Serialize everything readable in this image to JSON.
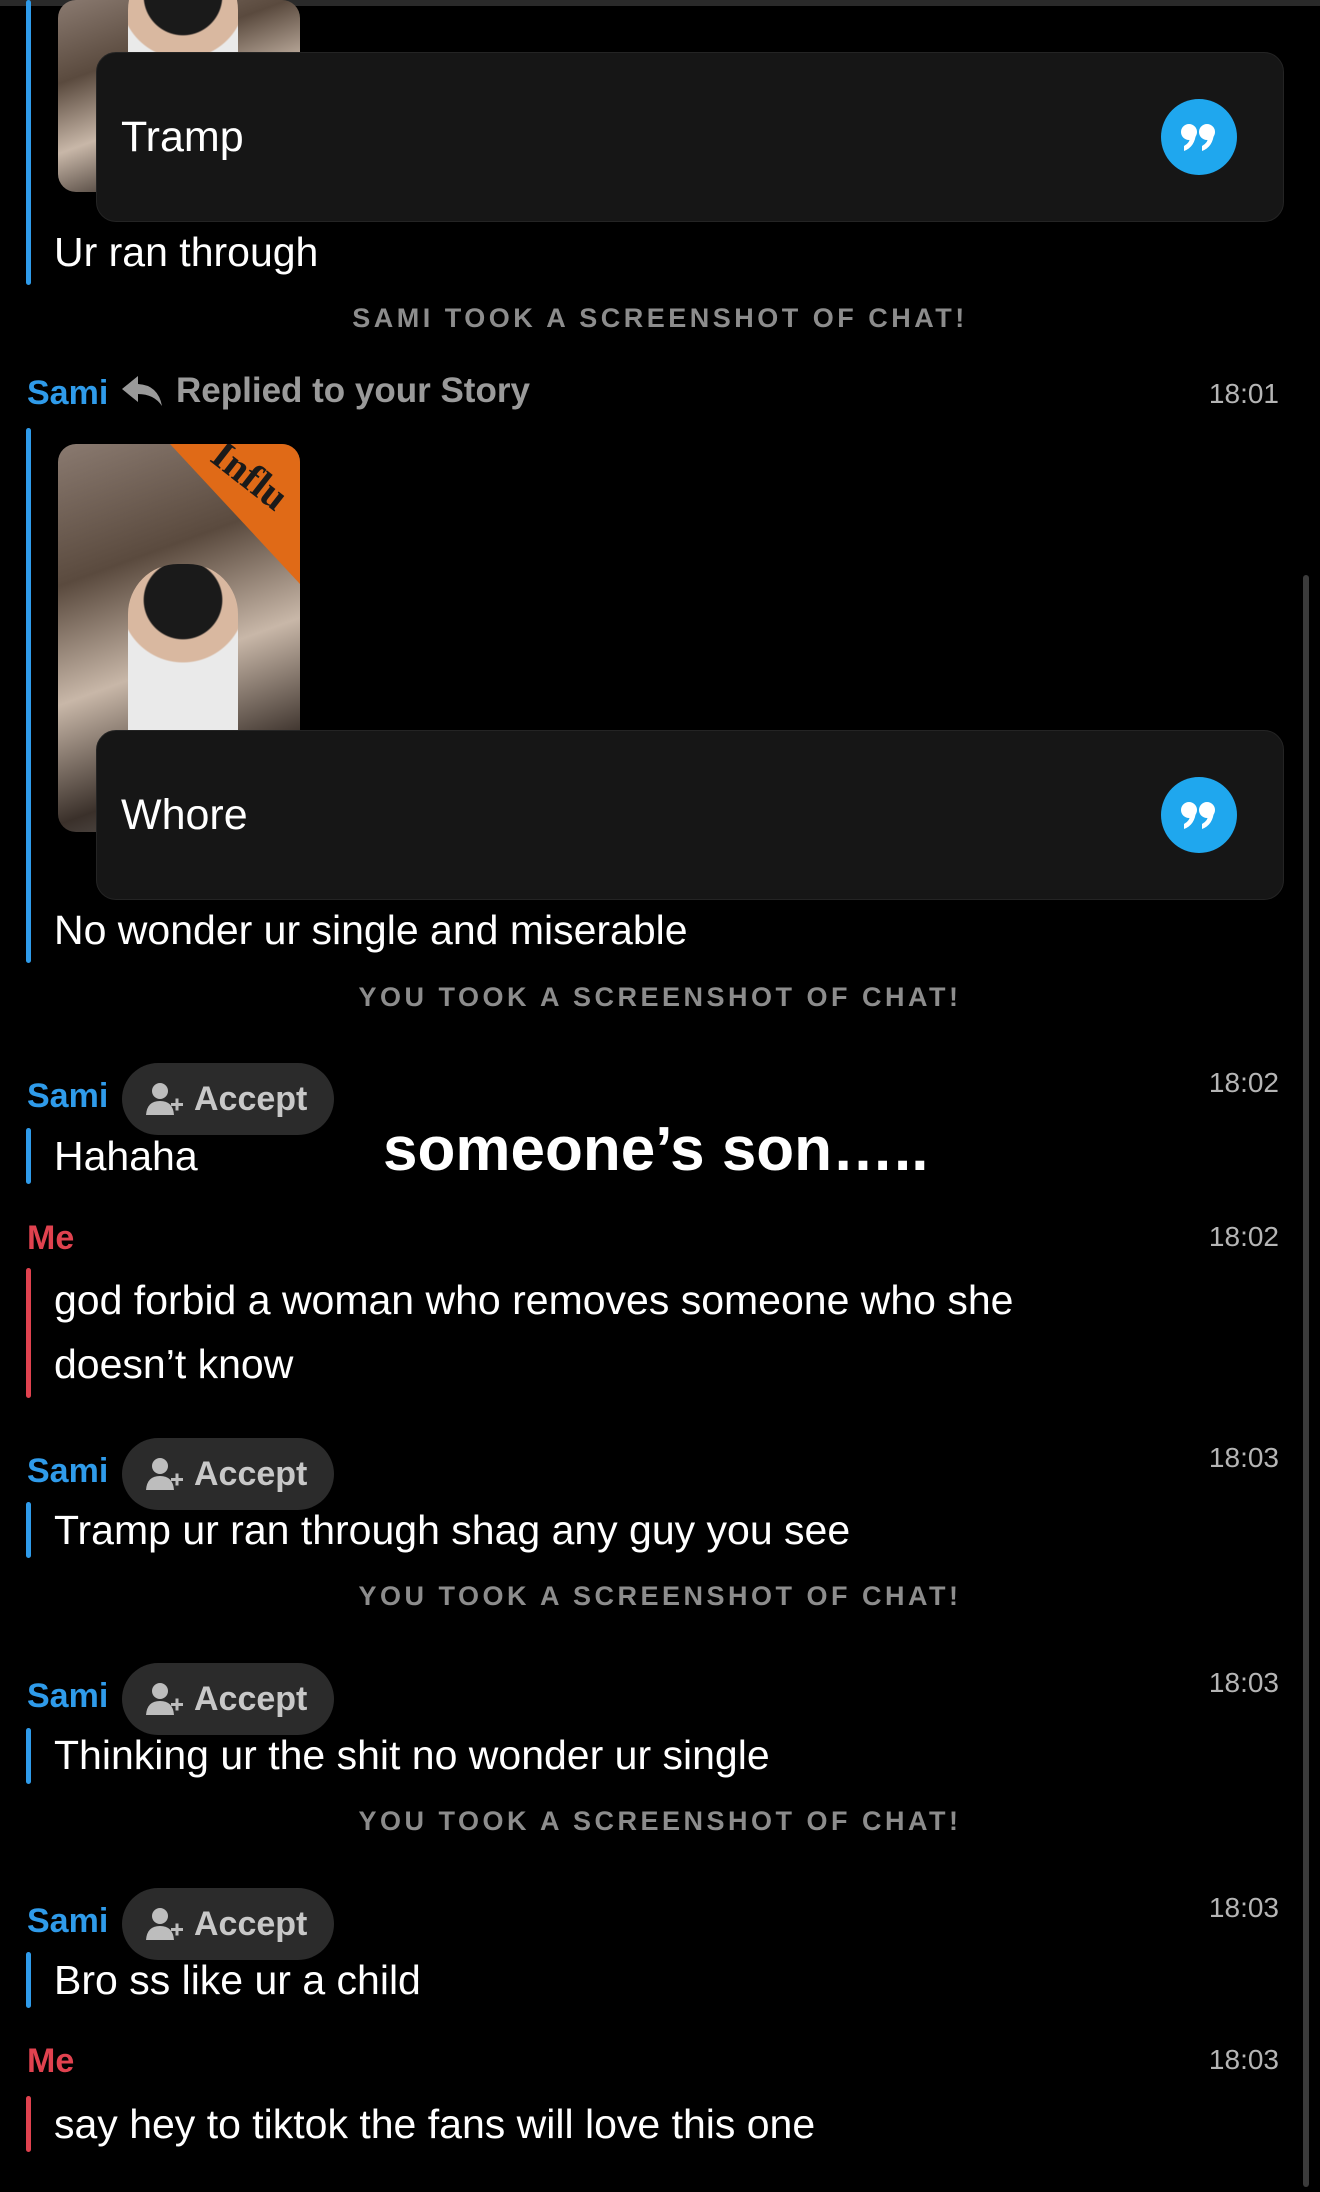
{
  "notices": {
    "sami_screenshot": "SAMI TOOK A SCREENSHOT OF CHAT!",
    "you_screenshot": "YOU TOOK A SCREENSHOT OF CHAT!"
  },
  "story_reply_1": {
    "quote_text": "Tramp",
    "message": "Ur ran  through"
  },
  "story_reply_2": {
    "sender": "Sami",
    "reply_label": "Replied to your Story",
    "time": "18:01",
    "thumbnail_text": "Influ",
    "quote_text": "Whore",
    "message": "No wonder ur single and miserable"
  },
  "overlay_caption": "someone’s son…..",
  "accept_label": "Accept",
  "messages": [
    {
      "sender": "Sami",
      "time": "18:02",
      "text": "Hahaha"
    },
    {
      "sender": "Me",
      "time": "18:02",
      "text_line1": "god forbid a woman who removes someone who she",
      "text_line2": "doesn’t know"
    },
    {
      "sender": "Sami",
      "time": "18:03",
      "text": "Tramp ur ran through shag any guy you see"
    },
    {
      "sender": "Sami",
      "time": "18:03",
      "text": "Thinking ur the shit no wonder ur single"
    },
    {
      "sender": "Sami",
      "time": "18:03",
      "text": "Bro ss like ur a child"
    },
    {
      "sender": "Me",
      "time": "18:03",
      "text": "say hey to tiktok the fans will love this one"
    }
  ],
  "colors": {
    "background": "#000000",
    "sami_blue": "#2f9bea",
    "me_red": "#e0424f",
    "quote_button": "#1fa7ee"
  },
  "icons": {
    "quote": "quote-icon",
    "reply_arrow": "reply-arrow-icon",
    "add_friend": "add-friend-icon"
  }
}
